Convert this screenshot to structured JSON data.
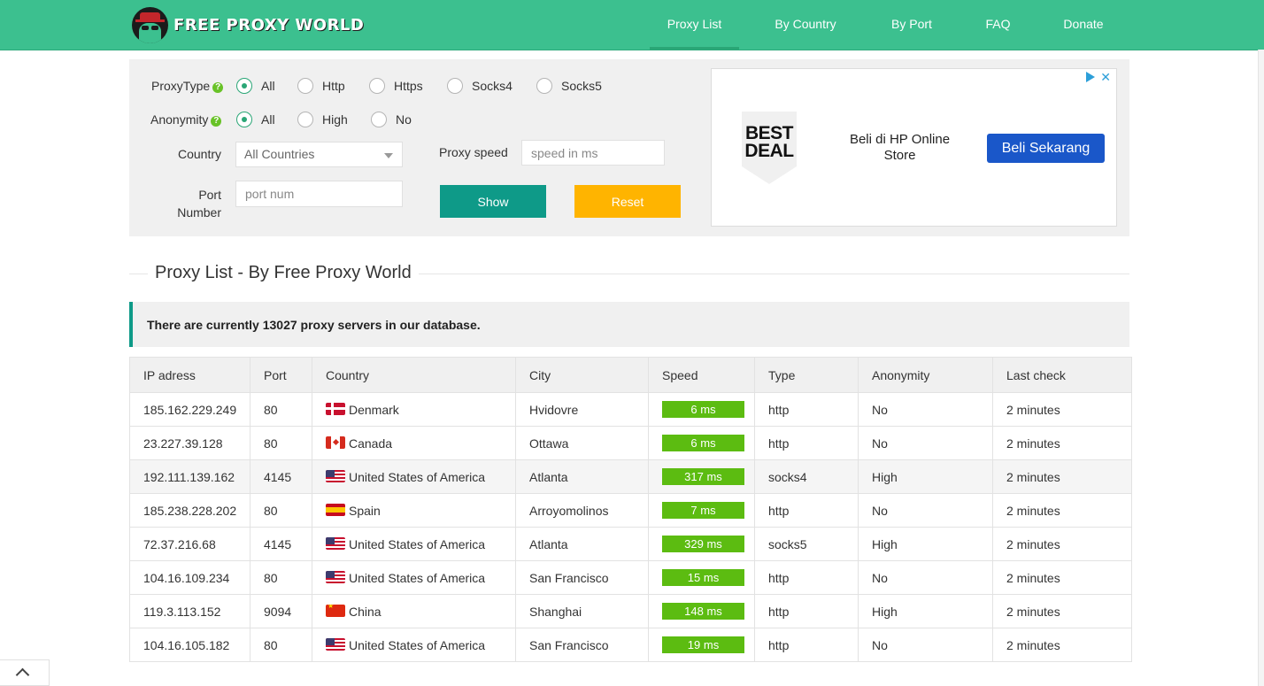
{
  "header": {
    "logo_text": "FREE PROXY WORLD",
    "nav": [
      {
        "label": "Proxy List",
        "active": true
      },
      {
        "label": "By Country",
        "active": false
      },
      {
        "label": "By Port",
        "active": false
      },
      {
        "label": "FAQ",
        "active": false
      },
      {
        "label": "Donate",
        "active": false
      }
    ]
  },
  "filters": {
    "proxy_type_label": "ProxyType",
    "proxy_type_options": [
      "All",
      "Http",
      "Https",
      "Socks4",
      "Socks5"
    ],
    "proxy_type_selected": "All",
    "anonymity_label": "Anonymity",
    "anonymity_options": [
      "All",
      "High",
      "No"
    ],
    "anonymity_selected": "All",
    "help_glyph": "?",
    "country_label": "Country",
    "country_value": "All Countries",
    "speed_label": "Proxy speed",
    "speed_placeholder": "speed in ms",
    "port_label_1": "Port",
    "port_label_2": "Number",
    "port_placeholder": "port num",
    "show_label": "Show",
    "reset_label": "Reset"
  },
  "ad": {
    "badge_line1": "BEST",
    "badge_line2": "DEAL",
    "text": "Beli di HP Online Store",
    "button": "Beli Sekarang",
    "close": "✕"
  },
  "section_title": "Proxy List - By Free Proxy World",
  "notice": "There are currently 13027 proxy servers in our database.",
  "table": {
    "columns": [
      "IP adress",
      "Port",
      "Country",
      "City",
      "Speed",
      "Type",
      "Anonymity",
      "Last check"
    ],
    "rows": [
      {
        "ip": "185.162.229.249",
        "port": "80",
        "flag": "dk",
        "country": "Denmark",
        "city": "Hvidovre",
        "speed": "6 ms",
        "type": "http",
        "anonymity": "No",
        "last": "2 minutes"
      },
      {
        "ip": "23.227.39.128",
        "port": "80",
        "flag": "ca",
        "country": "Canada",
        "city": "Ottawa",
        "speed": "6 ms",
        "type": "http",
        "anonymity": "No",
        "last": "2 minutes"
      },
      {
        "ip": "192.111.139.162",
        "port": "4145",
        "flag": "us",
        "country": "United States of America",
        "city": "Atlanta",
        "speed": "317 ms",
        "type": "socks4",
        "anonymity": "High",
        "last": "2 minutes"
      },
      {
        "ip": "185.238.228.202",
        "port": "80",
        "flag": "es",
        "country": "Spain",
        "city": "Arroyomolinos",
        "speed": "7 ms",
        "type": "http",
        "anonymity": "No",
        "last": "2 minutes"
      },
      {
        "ip": "72.37.216.68",
        "port": "4145",
        "flag": "us",
        "country": "United States of America",
        "city": "Atlanta",
        "speed": "329 ms",
        "type": "socks5",
        "anonymity": "High",
        "last": "2 minutes"
      },
      {
        "ip": "104.16.109.234",
        "port": "80",
        "flag": "us",
        "country": "United States of America",
        "city": "San Francisco",
        "speed": "15 ms",
        "type": "http",
        "anonymity": "No",
        "last": "2 minutes"
      },
      {
        "ip": "119.3.113.152",
        "port": "9094",
        "flag": "cn",
        "country": "China",
        "city": "Shanghai",
        "speed": "148 ms",
        "type": "http",
        "anonymity": "High",
        "last": "2 minutes"
      },
      {
        "ip": "104.16.105.182",
        "port": "80",
        "flag": "us",
        "country": "United States of America",
        "city": "San Francisco",
        "speed": "19 ms",
        "type": "http",
        "anonymity": "No",
        "last": "2 minutes"
      }
    ]
  },
  "colors": {
    "header_green": "#3cc08f",
    "teal": "#0e9a88",
    "reset_orange": "#ffb400",
    "speed_green": "#5cbc11",
    "ad_blue": "#1a57c9"
  }
}
